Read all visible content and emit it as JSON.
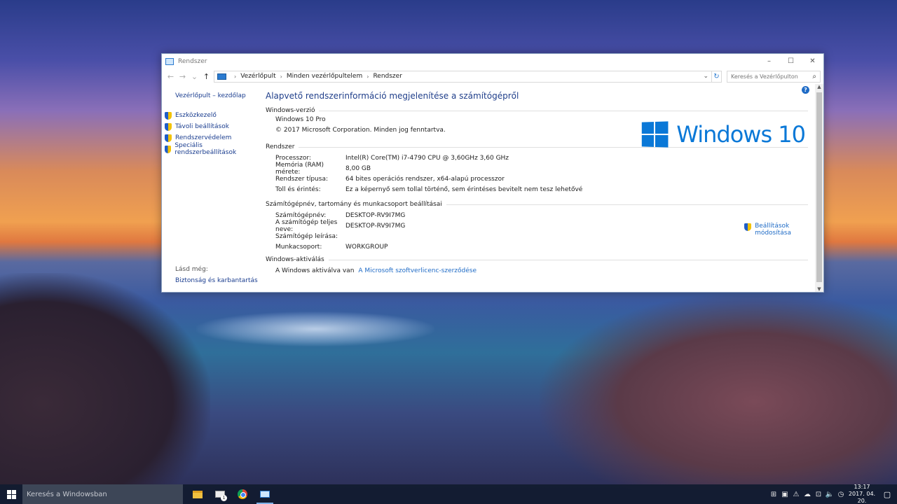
{
  "window": {
    "title": "Rendszer",
    "controls": {
      "minimize": "–",
      "maximize": "☐",
      "close": "✕"
    }
  },
  "address": {
    "back": "←",
    "forward": "→",
    "recent": "⌄",
    "up": "↑",
    "breadcrumbs": [
      "Vezérlőpult",
      "Minden vezérlőpultelem",
      "Rendszer"
    ],
    "separator": "›",
    "dropdown": "⌄",
    "refresh": "↻",
    "search_placeholder": "Keresés a Vezérlőpulton",
    "search_icon": "⌕"
  },
  "sidebar": {
    "home": "Vezérlőpult – kezdőlap",
    "tasks": [
      {
        "label": "Eszközkezelő",
        "icon": "uac-shield-icon"
      },
      {
        "label": "Távoli beállítások",
        "icon": "uac-shield-icon"
      },
      {
        "label": "Rendszervédelem",
        "icon": "uac-shield-icon"
      },
      {
        "label": "Speciális rendszerbeállítások",
        "icon": "uac-shield-icon"
      }
    ],
    "see_also": "Lásd még:",
    "see_also_link": "Biztonság és karbantartás"
  },
  "main": {
    "heading": "Alapvető rendszerinformáció megjelenítése a számítógépről",
    "help": "?",
    "edition": {
      "header": "Windows-verzió",
      "name": "Windows 10 Pro",
      "copyright": "© 2017 Microsoft Corporation. Minden jog fenntartva."
    },
    "logo_text": "Windows 10",
    "system": {
      "header": "Rendszer",
      "rows": [
        {
          "label": "Processzor:",
          "value": "Intel(R) Core(TM) i7-4790 CPU @ 3,60GHz   3,60 GHz"
        },
        {
          "label": "Memória (RAM) mérete:",
          "value": "8,00 GB"
        },
        {
          "label": "Rendszer típusa:",
          "value": "64 bites operációs rendszer, x64-alapú processzor"
        },
        {
          "label": "Toll és érintés:",
          "value": "Ez a képernyő sem tollal történő, sem érintéses bevitelt nem tesz lehetővé"
        }
      ]
    },
    "computer": {
      "header": "Számítógépnév, tartomány és munkacsoport beállításai",
      "rows": [
        {
          "label": "Számítógépnév:",
          "value": "DESKTOP-RV9I7MG"
        },
        {
          "label": "A számítógép teljes neve:",
          "value": "DESKTOP-RV9I7MG"
        },
        {
          "label": "Számítógép leírása:",
          "value": ""
        },
        {
          "label": "Munkacsoport:",
          "value": "WORKGROUP"
        }
      ],
      "change_line1": "Beállítások",
      "change_line2": "módosítása"
    },
    "activation": {
      "header": "Windows-aktiválás",
      "status": "A Windows aktiválva van",
      "link": "A Microsoft szoftverlicenc-szerződése"
    },
    "scroll_up": "▲",
    "scroll_down": "▼"
  },
  "taskbar": {
    "search_placeholder": "Keresés a Windowsban",
    "mail_badge": "1",
    "tray_icons": [
      "⊞",
      "▣",
      "⚠",
      "☁",
      "⊡",
      "🔈",
      "◷"
    ],
    "time": "13:17",
    "date": "2017. 04. 20.",
    "notification_icon": "▢"
  }
}
